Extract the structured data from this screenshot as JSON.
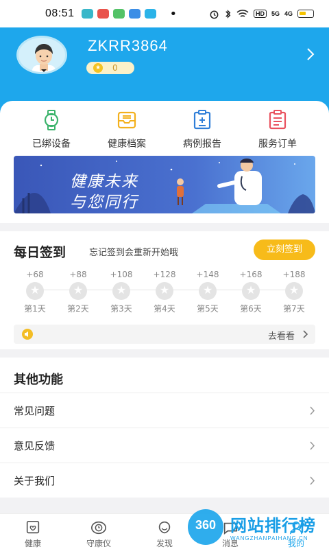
{
  "status_bar": {
    "time": "08:51",
    "app_icons": [
      "#39b7c9",
      "#e9534b",
      "#53c267",
      "#3c8ee6",
      "#2bb3e8"
    ],
    "dot": "•",
    "right_icons": [
      "alarm-icon",
      "bluetooth-icon",
      "wifi-icon",
      "hd-icon",
      "signal-5g-icon",
      "signal-4g-icon",
      "battery-icon"
    ],
    "hd_label": "HD",
    "net1_label": "5G",
    "net2_label": "4G"
  },
  "profile": {
    "username": "ZKRR3864",
    "coins": "0"
  },
  "quick_items": [
    {
      "label": "已绑设备",
      "icon": "watch-icon",
      "color": "#3bb36b"
    },
    {
      "label": "健康档案",
      "icon": "archive-tray-icon",
      "color": "#f3b01c"
    },
    {
      "label": "病例报告",
      "icon": "report-clipboard-icon",
      "color": "#2f7ed8"
    },
    {
      "label": "服务订单",
      "icon": "order-clipboard-icon",
      "color": "#e9515e"
    }
  ],
  "banner": {
    "line1": "健康未来",
    "line2": "与您同行"
  },
  "signin": {
    "title": "每日签到",
    "subtitle": "忘记签到会重新开始哦",
    "button": "立刻签到",
    "days": [
      {
        "points": "+68",
        "label": "第1天"
      },
      {
        "points": "+88",
        "label": "第2天"
      },
      {
        "points": "+108",
        "label": "第3天"
      },
      {
        "points": "+128",
        "label": "第4天"
      },
      {
        "points": "+148",
        "label": "第5天"
      },
      {
        "points": "+168",
        "label": "第6天"
      },
      {
        "points": "+188",
        "label": "第7天"
      }
    ],
    "notice_link": "去看看"
  },
  "other": {
    "title": "其他功能",
    "items": [
      "常见问题",
      "意见反馈",
      "关于我们"
    ]
  },
  "bottom_nav": [
    {
      "label": "健康",
      "icon": "health-icon"
    },
    {
      "label": "守康仪",
      "icon": "device-icon"
    },
    {
      "label": "发现",
      "icon": "discover-icon"
    },
    {
      "label": "消息",
      "icon": "message-icon"
    },
    {
      "label": "我的",
      "icon": "profile-icon"
    }
  ],
  "watermark": {
    "badge": "360",
    "text": "网站排行榜",
    "sub": "WANGZHANPAIHANG.CN"
  },
  "colors": {
    "brand_blue": "#1ea7ec",
    "signin_yellow": "#f7bb1a"
  }
}
